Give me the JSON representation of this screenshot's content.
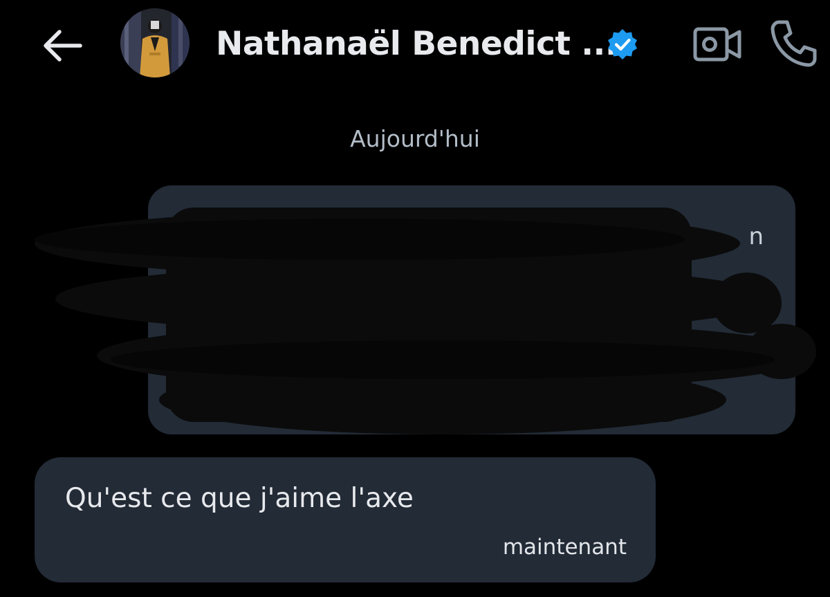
{
  "header": {
    "contact_name": "Nathanaël Benedict ...",
    "verified": true,
    "icons": {
      "back": "arrow-left-icon",
      "verified": "verified-badge-icon",
      "video": "video-camera-icon",
      "call": "phone-icon"
    }
  },
  "conversation": {
    "date_divider": "Aujourd'hui",
    "shared_post": {
      "content": "",
      "visible_fragment": "n"
    },
    "messages": [
      {
        "text": "Qu'est ce que j'aime l'axe",
        "timestamp": "maintenant"
      }
    ]
  },
  "colors": {
    "background": "#000000",
    "bubble": "#222b36",
    "accent_blue": "#1d9bf0",
    "text_primary": "#e7e9ed",
    "text_secondary": "#b3bdc8",
    "icon_gray": "#8b98a5"
  }
}
